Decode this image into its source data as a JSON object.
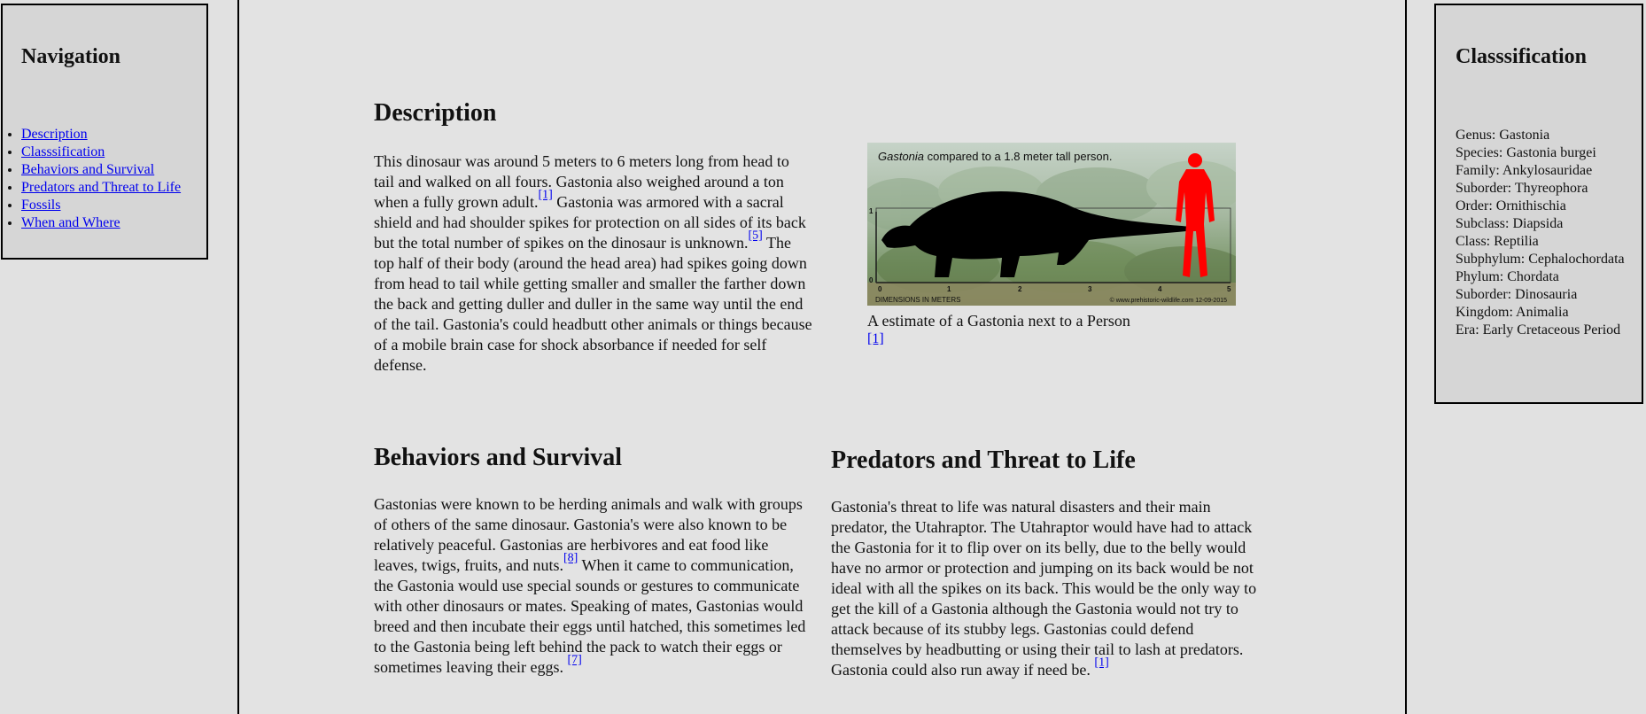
{
  "navigation": {
    "title": "Navigation",
    "links": [
      "Description",
      "Classsification",
      "Behaviors and Survival",
      "Predators and Threat to Life",
      "Fossils",
      "When and Where"
    ]
  },
  "classification": {
    "title": "Classsification",
    "rows": [
      "Genus: Gastonia",
      "Species: Gastonia burgei",
      "Family: Ankylosauridae",
      "Suborder: Thyreophora",
      "Order: Ornithischia",
      "Subclass: Diapsida",
      "Class: Reptilia",
      "Subphylum: Cephalochordata",
      "Phylum: Chordata",
      "Suborder: Dinosauria",
      "Kingdom: Animalia",
      "Era: Early Cretaceous Period"
    ]
  },
  "description": {
    "title": "Description",
    "text_1": "This dinosaur was around 5 meters to 6 meters long from head to tail and walked on all fours. Gastonia also weighed around a ton when a fully grown adult.",
    "ref_1": "[1]",
    "text_2": " Gastonia was armored with a sacral shield and had shoulder spikes for protection on all sides of its back but the total number of spikes on the dinosaur is unknown.",
    "ref_2": "[5]",
    "text_3": " The top half of their body (around the head area) had spikes going down from head to tail while getting smaller and smaller the farther down the back and getting duller and duller in the same way until the end of the tail. Gastonia's could headbutt other animals or things because of a mobile brain case for shock absorbance if needed for self defense."
  },
  "figure": {
    "header_italic": "Gastonia",
    "header_rest": " compared to a 1.8 meter tall person.",
    "axis_label": "DIMENSIONS IN METERS",
    "credit": "© www.prehistoric-wildlife.com 12-09-2015",
    "x_ticks": [
      "0",
      "1",
      "2",
      "3",
      "4",
      "5"
    ],
    "y_ticks": [
      "1",
      "0"
    ],
    "caption": "A estimate of a Gastonia next to a Person",
    "ref": "[1]"
  },
  "behaviors": {
    "title": "Behaviors and Survival",
    "text_1": "Gastonias were known to be herding animals and walk with groups of others of the same dinosaur. Gastonia's were also known to be relatively peaceful. Gastonias are herbivores and eat food like leaves, twigs, fruits, and nuts.",
    "ref_1": "[8]",
    "text_2": " When it came to communication, the Gastonia would use special sounds or gestures to communicate with other dinosaurs or mates. Speaking of mates, Gastonias would breed and then incubate their eggs until hatched, this sometimes led to the Gastonia being left behind the pack to watch their eggs or sometimes leaving their eggs. ",
    "ref_2": "[7]"
  },
  "predators": {
    "title": "Predators and Threat to Life",
    "text_1": "Gastonia's threat to life was natural disasters and their main predator, the Utahraptor. The Utahraptor would have had to attack the Gastonia for it to flip over on its belly, due to the belly would have no armor or protection and jumping on its back would be not ideal with all the spikes on its back. This would be the only way to get the kill of a Gastonia although the Gastonia would not try to attack because of its stubby legs. Gastonias could defend themselves by headbutting or using their tail to lash at predators. Gastonia could also run away if need be. ",
    "ref_1": "[1]"
  },
  "colors": {
    "background": "#e1e1e1",
    "link": "#0000ee",
    "silhouette_person": "#ff0000",
    "silhouette_dino": "#000000"
  }
}
